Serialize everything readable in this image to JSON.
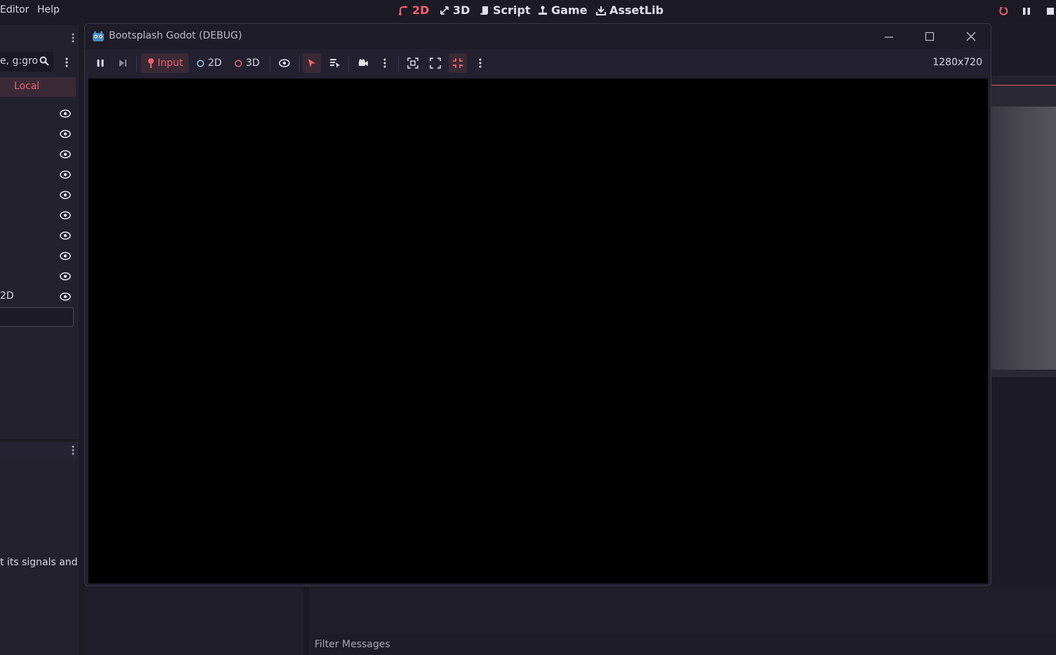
{
  "menubar": {
    "items": [
      "Editor",
      "Help"
    ],
    "workspaces": [
      {
        "label": "2D",
        "icon": "2d-icon",
        "active": true
      },
      {
        "label": "3D",
        "icon": "3d-icon"
      },
      {
        "label": "Script",
        "icon": "script-icon"
      },
      {
        "label": "Game",
        "icon": "game-icon"
      },
      {
        "label": "AssetLib",
        "icon": "assetlib-icon"
      }
    ]
  },
  "scene_dock": {
    "filter_text": "e, g:gro",
    "local_tab": "Local",
    "last_item_label": "2D"
  },
  "node_dock": {
    "help_text": "t its signals and"
  },
  "game_window": {
    "title": "Bootsplash Godot (DEBUG)",
    "toolbar": {
      "input_label": "Input",
      "label_2d": "2D",
      "label_3d": "3D"
    },
    "resolution": "1280x720"
  },
  "bottom_panel": {
    "filter_placeholder": "Filter Messages"
  },
  "colors": {
    "accent": "#f0606e",
    "background": "#1d1b26",
    "viewport": "#000000"
  }
}
